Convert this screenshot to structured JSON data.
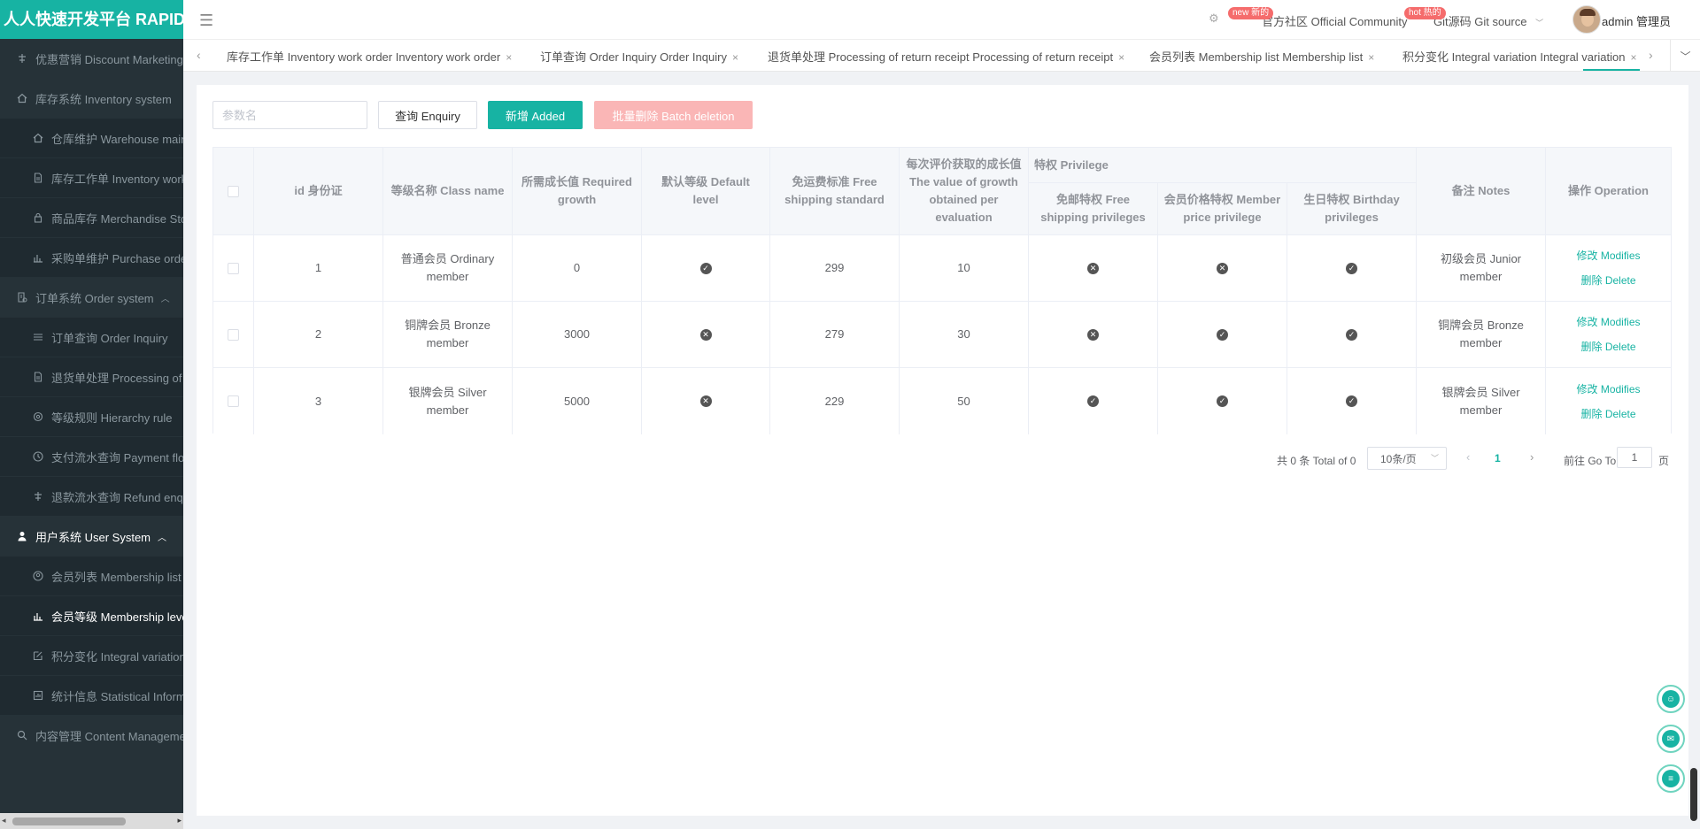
{
  "brand": "人人快速开发平台 RAPID",
  "sidebar": {
    "items": [
      {
        "label": "优惠营销 Discount Marketing",
        "icon": "discount-icon"
      },
      {
        "label": "库存系统 Inventory system",
        "icon": "home-icon"
      },
      {
        "label": "仓库维护 Warehouse maintenance",
        "icon": "warehouse-icon"
      },
      {
        "label": "库存工作单 Inventory work order",
        "icon": "document-icon"
      },
      {
        "label": "商品库存 Merchandise Stock",
        "icon": "lock-icon"
      },
      {
        "label": "采购单维护 Purchase order",
        "icon": "bar-chart-icon"
      },
      {
        "label": "订单系统 Order system",
        "icon": "order-icon"
      },
      {
        "label": "订单查询 Order Inquiry",
        "icon": "list-icon"
      },
      {
        "label": "退货单处理 Processing of return receipt",
        "icon": "document-icon"
      },
      {
        "label": "等级规则 Hierarchy rule",
        "icon": "gear-icon"
      },
      {
        "label": "支付流水查询 Payment flow",
        "icon": "clock-icon"
      },
      {
        "label": "退款流水查询 Refund enquiry",
        "icon": "discount-icon"
      },
      {
        "label": "用户系统 User System",
        "icon": "user-icon"
      },
      {
        "label": "会员列表 Membership list",
        "icon": "member-icon"
      },
      {
        "label": "会员等级 Membership level",
        "icon": "bar-chart-icon"
      },
      {
        "label": "积分变化 Integral variation",
        "icon": "edit-icon"
      },
      {
        "label": "统计信息 Statistical Information",
        "icon": "stats-icon"
      },
      {
        "label": "内容管理 Content Management",
        "icon": "search-icon"
      }
    ]
  },
  "topbar": {
    "community_badge": "new 新的",
    "community": "官方社区 Official Community",
    "git_badge": "hot 热的",
    "git": "Git源码 Git source",
    "user": "admin 管理员"
  },
  "tabs": [
    {
      "label": "库存工作单 Inventory work order Inventory work order"
    },
    {
      "label": "订单查询 Order Inquiry Order Inquiry"
    },
    {
      "label": "退货单处理 Processing of return receipt Processing of return receipt"
    },
    {
      "label": "会员列表 Membership list Membership list"
    },
    {
      "label": "积分变化 Integral variation Integral variation"
    }
  ],
  "toolbar": {
    "search_placeholder": "参数名",
    "query_label": "查询 Enquiry",
    "add_label": "新增 Added",
    "batch_delete_label": "批量删除 Batch deletion"
  },
  "table": {
    "headers": {
      "id": "id 身份证",
      "class_name": "等级名称 Class name",
      "required_growth": "所需成长值 Required growth",
      "default_level": "默认等级 Default level",
      "free_shipping_standard": "免运费标准 Free shipping standard",
      "growth_per_review": "每次评价获取的成长值 The value of growth obtained per evaluation",
      "privilege": "特权 Privilege",
      "free_shipping_privileges": "免邮特权 Free shipping privileges",
      "member_price_privilege": "会员价格特权 Member price privilege",
      "birthday_privileges": "生日特权 Birthday privileges",
      "notes": "备注 Notes",
      "operation": "操作 Operation"
    },
    "rows": [
      {
        "id": "1",
        "class_name": "普通会员 Ordinary member",
        "required_growth": "0",
        "default_level": true,
        "free_shipping_standard": "299",
        "growth_per_review": "10",
        "free_shipping_privileges": false,
        "member_price_privilege": false,
        "birthday_privileges": true,
        "notes": "初级会员 Junior member"
      },
      {
        "id": "2",
        "class_name": "铜牌会员 Bronze member",
        "required_growth": "3000",
        "default_level": false,
        "free_shipping_standard": "279",
        "growth_per_review": "30",
        "free_shipping_privileges": false,
        "member_price_privilege": true,
        "birthday_privileges": true,
        "notes": "铜牌会员 Bronze member"
      },
      {
        "id": "3",
        "class_name": "银牌会员 Silver member",
        "required_growth": "5000",
        "default_level": false,
        "free_shipping_standard": "229",
        "growth_per_review": "50",
        "free_shipping_privileges": true,
        "member_price_privilege": true,
        "birthday_privileges": true,
        "notes": "银牌会员 Silver member"
      }
    ],
    "modify_label": "修改 Modifies",
    "delete_label": "删除 Delete"
  },
  "pagination": {
    "total": "共 0 条 Total of 0",
    "page_size": "10条/页",
    "current_page": "1",
    "goto_label": "前往 Go To",
    "goto_value": "1",
    "page_suffix": "页"
  },
  "colors": {
    "accent": "#17b3a3",
    "sidebar": "#263238",
    "danger_disabled": "#fab6b6"
  }
}
